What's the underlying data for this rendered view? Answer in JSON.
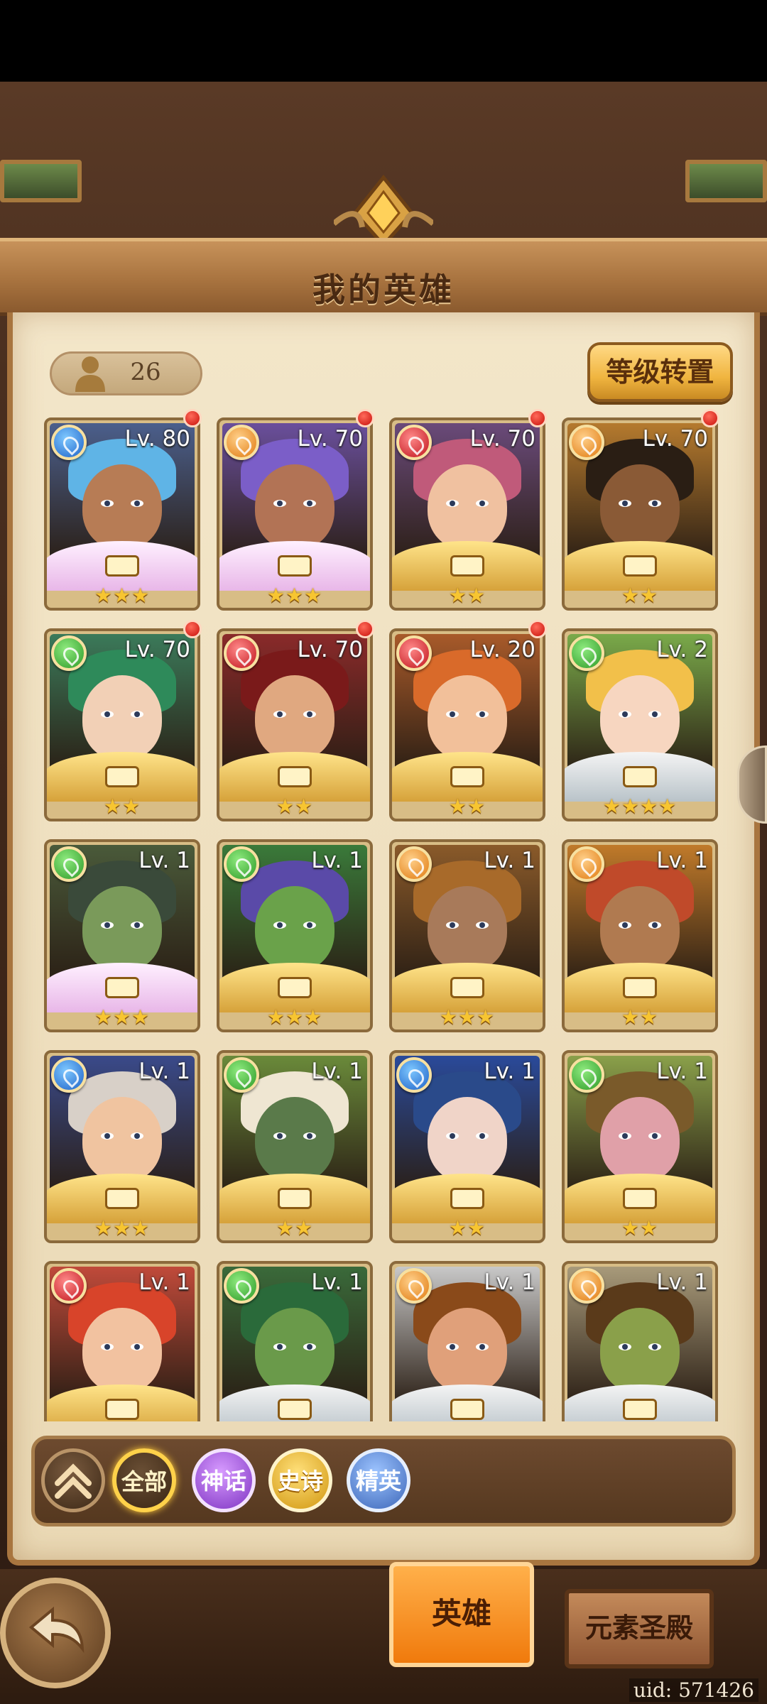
{
  "header": {
    "title": "我的英雄"
  },
  "toolbar": {
    "hero_count": "26",
    "level_transfer_label": "等级转置"
  },
  "heroes": [
    {
      "level": "Lv. 80",
      "element": "water",
      "stars": "★★★",
      "frame": "pink",
      "badge": true,
      "hair": "#5fb4e6",
      "skin": "#b77c55",
      "bg": "#4b5f8c"
    },
    {
      "level": "Lv. 70",
      "element": "earth",
      "stars": "★★★",
      "frame": "pink",
      "badge": true,
      "hair": "#7b5ec8",
      "skin": "#b27355",
      "bg": "#6a4f9c"
    },
    {
      "level": "Lv. 70",
      "element": "fire",
      "stars": "★★",
      "frame": "gold",
      "badge": true,
      "hair": "#c05a7a",
      "skin": "#f0c1a0",
      "bg": "#6a4a7a"
    },
    {
      "level": "Lv. 70",
      "element": "earth",
      "stars": "★★",
      "frame": "gold",
      "badge": true,
      "hair": "#2a1e14",
      "skin": "#8a5a36",
      "bg": "#b57a2e"
    },
    {
      "level": "Lv. 70",
      "element": "nature",
      "stars": "★★",
      "frame": "gold",
      "badge": true,
      "hair": "#2e8a5a",
      "skin": "#f2d0b6",
      "bg": "#3b7a5a"
    },
    {
      "level": "Lv. 70",
      "element": "fire",
      "stars": "★★",
      "frame": "gold",
      "badge": true,
      "hair": "#7a1a1a",
      "skin": "#e0a880",
      "bg": "#8a2a2a"
    },
    {
      "level": "Lv. 20",
      "element": "fire",
      "stars": "★★",
      "frame": "gold",
      "badge": true,
      "hair": "#d96a2a",
      "skin": "#f2c09a",
      "bg": "#a85a2a"
    },
    {
      "level": "Lv. 2",
      "element": "nature",
      "stars": "★★★★",
      "frame": "silver",
      "badge": false,
      "hair": "#f2c04a",
      "skin": "#f7d6c0",
      "bg": "#7aaa4a"
    },
    {
      "level": "Lv. 1",
      "element": "nature",
      "stars": "★★★",
      "frame": "pink",
      "badge": false,
      "hair": "#3a4a3a",
      "skin": "#7a9a5a",
      "bg": "#4a5a3a"
    },
    {
      "level": "Lv. 1",
      "element": "nature",
      "stars": "★★★",
      "frame": "gold",
      "badge": false,
      "hair": "#5a4aa8",
      "skin": "#6aa24a",
      "bg": "#3a7a3a"
    },
    {
      "level": "Lv. 1",
      "element": "earth",
      "stars": "★★★",
      "frame": "gold",
      "badge": false,
      "hair": "#a86a2a",
      "skin": "#a87a5a",
      "bg": "#8a5a2a"
    },
    {
      "level": "Lv. 1",
      "element": "earth",
      "stars": "★★",
      "frame": "gold",
      "badge": false,
      "hair": "#c04a2a",
      "skin": "#b07a50",
      "bg": "#c07a2a"
    },
    {
      "level": "Lv. 1",
      "element": "water",
      "stars": "★★★",
      "frame": "gold",
      "badge": false,
      "hair": "#d8d0c8",
      "skin": "#f0c4a0",
      "bg": "#3a4a8a"
    },
    {
      "level": "Lv. 1",
      "element": "nature",
      "stars": "★★",
      "frame": "gold",
      "badge": false,
      "hair": "#efe6d2",
      "skin": "#5a7a4a",
      "bg": "#6a8a3a"
    },
    {
      "level": "Lv. 1",
      "element": "water",
      "stars": "★★",
      "frame": "gold",
      "badge": false,
      "hair": "#2a4a8a",
      "skin": "#f0d4c8",
      "bg": "#2a4a9a"
    },
    {
      "level": "Lv. 1",
      "element": "nature",
      "stars": "★★",
      "frame": "gold",
      "badge": false,
      "hair": "#7a5a2a",
      "skin": "#e0a0a8",
      "bg": "#8aa04a"
    },
    {
      "level": "Lv. 1",
      "element": "fire",
      "stars": "",
      "frame": "gold",
      "badge": false,
      "hair": "#d8442a",
      "skin": "#f2c2a0",
      "bg": "#c04a3a"
    },
    {
      "level": "Lv. 1",
      "element": "nature",
      "stars": "",
      "frame": "silver",
      "badge": false,
      "hair": "#2a6a3a",
      "skin": "#6a9a4a",
      "bg": "#3a6a3a"
    },
    {
      "level": "Lv. 1",
      "element": "earth",
      "stars": "",
      "frame": "silver",
      "badge": false,
      "hair": "#8a4a1a",
      "skin": "#e0a07a",
      "bg": "#c8c8c8"
    },
    {
      "level": "Lv. 1",
      "element": "earth",
      "stars": "",
      "frame": "silver",
      "badge": false,
      "hair": "#5a3a1a",
      "skin": "#8aa04a",
      "bg": "#a89a7a"
    }
  ],
  "filters": {
    "all": "全部",
    "myth": "神话",
    "epic": "史诗",
    "elite": "精英"
  },
  "bottom_tabs": {
    "heroes": "英雄",
    "shrine": "元素圣殿"
  },
  "uid": "uid: 571426"
}
